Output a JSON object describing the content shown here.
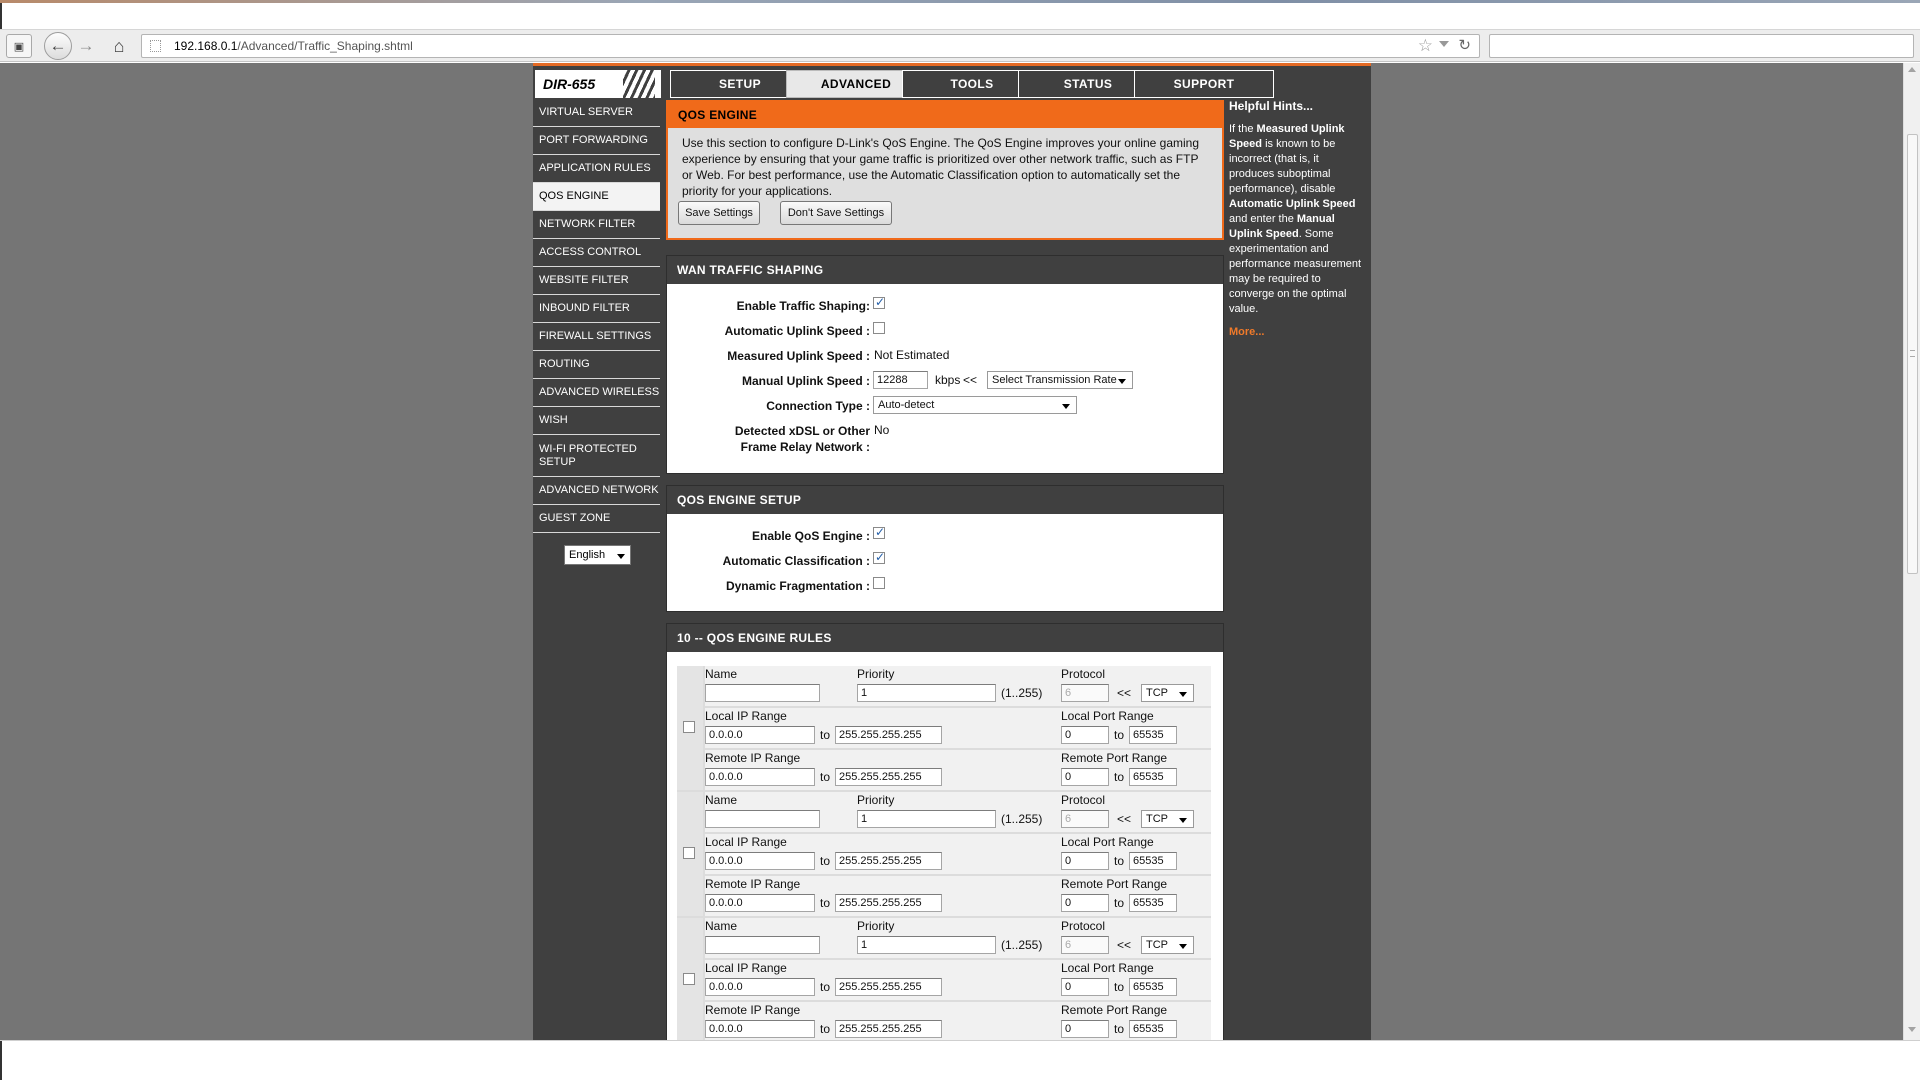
{
  "browser": {
    "url_host": "192.168.0.1",
    "url_path": "/Advanced/Traffic_Shaping.shtml"
  },
  "logo": {
    "model": "DIR-655"
  },
  "tabs": [
    "SETUP",
    "ADVANCED",
    "TOOLS",
    "STATUS",
    "SUPPORT"
  ],
  "sidebar": {
    "items": [
      "VIRTUAL SERVER",
      "PORT FORWARDING",
      "APPLICATION RULES",
      "QOS ENGINE",
      "NETWORK FILTER",
      "ACCESS CONTROL",
      "WEBSITE FILTER",
      "INBOUND FILTER",
      "FIREWALL SETTINGS",
      "ROUTING",
      "ADVANCED WIRELESS",
      "WISH",
      "WI-FI PROTECTED SETUP",
      "ADVANCED NETWORK",
      "GUEST ZONE"
    ],
    "language": "English"
  },
  "qos": {
    "title": "QOS ENGINE",
    "description": "Use this section to configure D-Link's QoS Engine. The QoS Engine improves your online gaming experience by ensuring that your game traffic is prioritized over other network traffic, such as FTP or Web. For best performance, use the Automatic Classification option to automatically set the priority for your applications.",
    "save_label": "Save Settings",
    "dont_save_label": "Don't Save Settings"
  },
  "wan": {
    "title": "WAN TRAFFIC SHAPING",
    "enable_label": "Enable Traffic Shaping:",
    "enable_checked": true,
    "auto_uplink_label": "Automatic Uplink Speed :",
    "auto_uplink_checked": false,
    "measured_label": "Measured Uplink Speed :",
    "measured_value": "Not Estimated",
    "manual_label": "Manual Uplink Speed :",
    "manual_value": "12288",
    "manual_unit": "kbps",
    "arrows": "<<",
    "rate_select": "Select Transmission Rate",
    "conn_label": "Connection Type :",
    "conn_value": "Auto-detect",
    "xdsl_label_1": "Detected xDSL or Other",
    "xdsl_label_2": "Frame Relay Network :",
    "xdsl_value": "No"
  },
  "setup": {
    "title": "QOS ENGINE SETUP",
    "enable_label": "Enable QoS Engine :",
    "enable_checked": true,
    "auto_class_label": "Automatic Classification :",
    "auto_class_checked": true,
    "dyn_frag_label": "Dynamic Fragmentation :",
    "dyn_frag_checked": false
  },
  "rules": {
    "title": "10 -- QOS ENGINE RULES",
    "labels": {
      "name": "Name",
      "priority": "Priority",
      "priority_range": "(1..255)",
      "protocol": "Protocol",
      "arrows": "<<",
      "local_ip": "Local IP Range",
      "local_port": "Local Port Range",
      "remote_ip": "Remote IP Range",
      "remote_port": "Remote Port Range",
      "to": "to"
    },
    "items": [
      {
        "name": "",
        "priority": "1",
        "protocol_num": "6",
        "protocol": "TCP",
        "local_ip_start": "0.0.0.0",
        "local_ip_end": "255.255.255.255",
        "local_port_start": "0",
        "local_port_end": "65535",
        "remote_ip_start": "0.0.0.0",
        "remote_ip_end": "255.255.255.255",
        "remote_port_start": "0",
        "remote_port_end": "65535"
      },
      {
        "name": "",
        "priority": "1",
        "protocol_num": "6",
        "protocol": "TCP",
        "local_ip_start": "0.0.0.0",
        "local_ip_end": "255.255.255.255",
        "local_port_start": "0",
        "local_port_end": "65535",
        "remote_ip_start": "0.0.0.0",
        "remote_ip_end": "255.255.255.255",
        "remote_port_start": "0",
        "remote_port_end": "65535"
      },
      {
        "name": "",
        "priority": "1",
        "protocol_num": "6",
        "protocol": "TCP",
        "local_ip_start": "0.0.0.0",
        "local_ip_end": "255.255.255.255",
        "local_port_start": "0",
        "local_port_end": "65535",
        "remote_ip_start": "0.0.0.0",
        "remote_ip_end": "255.255.255.255",
        "remote_port_start": "0",
        "remote_port_end": "65535"
      }
    ]
  },
  "hints": {
    "title": "Helpful Hints...",
    "t1": "If the ",
    "b1": "Measured Uplink Speed",
    "t2": " is known to be incorrect (that is, it produces suboptimal performance), disable ",
    "b2": "Automatic Uplink Speed",
    "t3": " and enter the ",
    "b3": "Manual Uplink Speed",
    "t4": ". Some experimentation and performance measurement may be required to converge on the optimal value.",
    "more": "More..."
  },
  "colors": {
    "accent": "#f06a1a",
    "nav_bg": "#404040",
    "page_bg": "#757575"
  }
}
